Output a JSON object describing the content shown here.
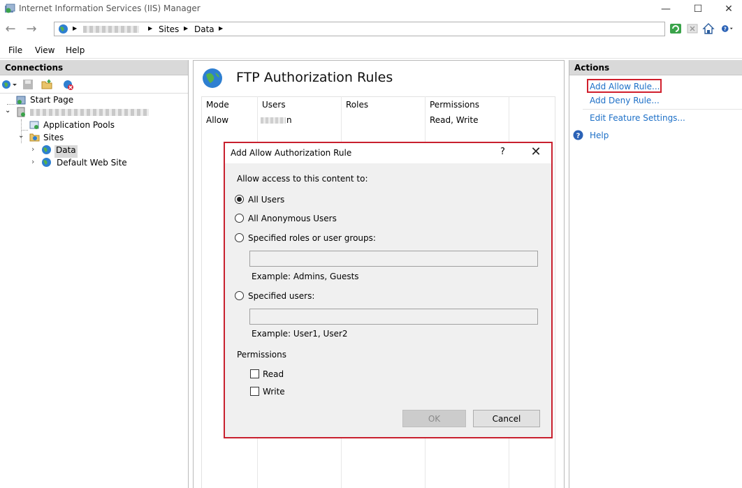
{
  "window": {
    "title": "Internet Information Services (IIS) Manager",
    "minimize_glyph": "—",
    "maximize_glyph": "☐",
    "close_glyph": "✕"
  },
  "address": {
    "crumbs": [
      "Sites",
      "Data"
    ]
  },
  "menu": [
    "File",
    "View",
    "Help"
  ],
  "connections": {
    "header": "Connections",
    "tree": {
      "start_page": "Start Page",
      "application_pools": "Application Pools",
      "sites": "Sites",
      "data": "Data",
      "default_web_site": "Default Web Site"
    }
  },
  "feature": {
    "title": "FTP Authorization Rules",
    "columns": [
      "Mode",
      "Users",
      "Roles",
      "Permissions"
    ],
    "rows": [
      {
        "mode": "Allow",
        "users_suffix": "n",
        "roles": "",
        "permissions": "Read, Write"
      }
    ]
  },
  "actions": {
    "header": "Actions",
    "add_allow": "Add Allow Rule...",
    "add_deny": "Add Deny Rule...",
    "edit_feature": "Edit Feature Settings...",
    "help": "Help"
  },
  "dialog": {
    "title": "Add Allow Authorization Rule",
    "help_glyph": "?",
    "prompt": "Allow access to this content to:",
    "options": {
      "all_users": "All Users",
      "all_anonymous": "All Anonymous Users",
      "specified_roles": "Specified roles or user groups:",
      "specified_users": "Specified users:"
    },
    "selected_option": "all_users",
    "roles_example": "Example: Admins, Guests",
    "users_example": "Example: User1, User2",
    "roles_value": "",
    "users_value": "",
    "permissions_label": "Permissions",
    "read_label": "Read",
    "write_label": "Write",
    "read_checked": false,
    "write_checked": false,
    "ok_label": "OK",
    "cancel_label": "Cancel"
  },
  "colors": {
    "link": "#1c6fc7",
    "highlight_border": "#d01f2c",
    "panel_header": "#d9d9d9"
  }
}
